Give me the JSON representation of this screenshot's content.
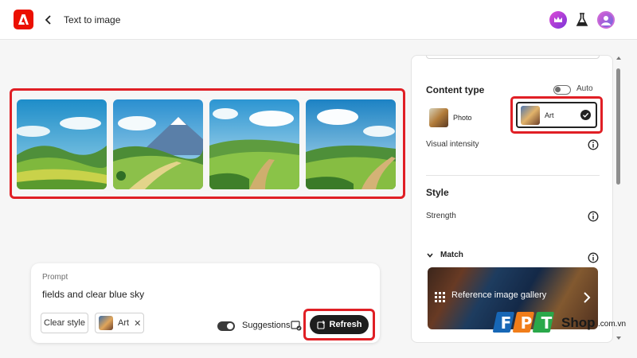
{
  "header": {
    "title": "Text to image",
    "logo_icon": "adobe-firefly-logo",
    "back_icon": "chevron-left-icon",
    "crown_icon": "premium-crown-icon",
    "flask_icon": "labs-flask-icon",
    "avatar_icon": "user-avatar-icon"
  },
  "gallery": {
    "images": [
      "generated-landscape-1",
      "generated-landscape-2",
      "generated-landscape-3",
      "generated-landscape-4"
    ],
    "highlight_color": "#e01f25"
  },
  "prompt": {
    "label": "Prompt",
    "text": "fields and clear blue sky",
    "clear_style_label": "Clear style",
    "art_chip_label": "Art",
    "remove_icon": "close-icon",
    "suggestions_label": "Suggestions",
    "suggestions_on": true,
    "refresh_label": "Refresh"
  },
  "settings": {
    "content_type_title": "Content type",
    "auto_label": "Auto",
    "auto_on": false,
    "options": [
      {
        "label": "Photo",
        "selected": false
      },
      {
        "label": "Art",
        "selected": true
      }
    ],
    "visual_intensity_label": "Visual intensity",
    "style_title": "Style",
    "strength_label": "Strength",
    "match_label": "Match",
    "reference_gallery_label": "Reference image gallery"
  },
  "watermark": {
    "brand": "FPT",
    "suffix": "Shop",
    "domain": ".com.vn"
  }
}
